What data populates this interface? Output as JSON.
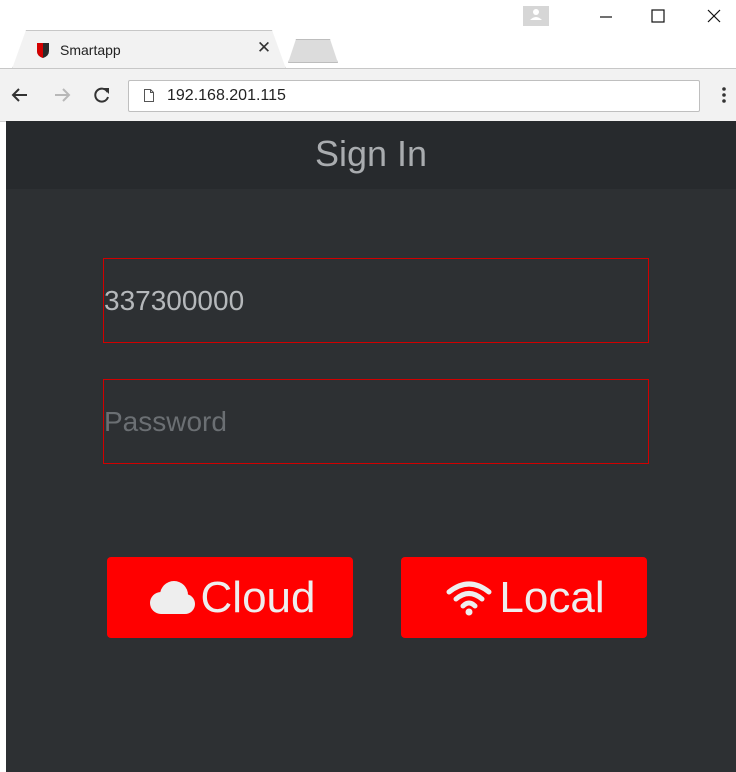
{
  "browser": {
    "tab_title": "Smartapp",
    "url": "192.168.201.115"
  },
  "page": {
    "header_title": "Sign In",
    "username_value": "337300000",
    "password_placeholder": "Password",
    "cloud_label": "Cloud",
    "local_label": "Local"
  },
  "colors": {
    "page_bg": "#2d3033",
    "header_bg": "#272a2d",
    "accent_red": "#ff0000",
    "field_border": "#d10000"
  },
  "icons": {
    "tab_favicon": "shield-icon",
    "tab_close": "close-icon",
    "back": "arrow-left-icon",
    "forward": "arrow-right-icon",
    "reload": "reload-icon",
    "page_info": "page-icon",
    "menu": "more-vert-icon",
    "cloud_button": "cloud-icon",
    "local_button": "wifi-icon"
  }
}
